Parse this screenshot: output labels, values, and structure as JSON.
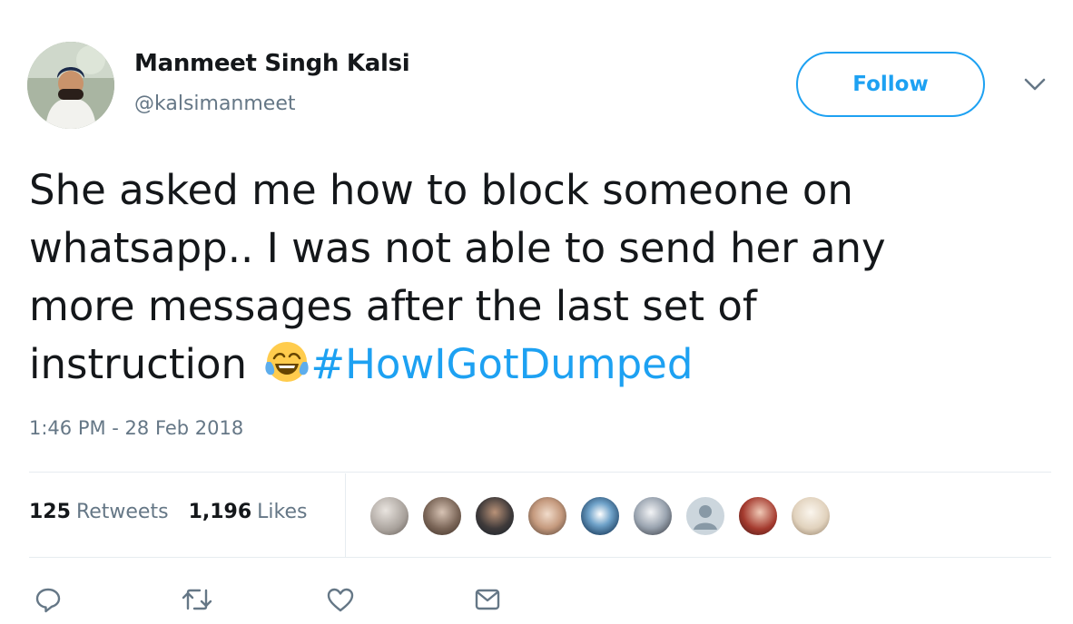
{
  "user": {
    "display_name": "Manmeet Singh Kalsi",
    "handle": "@kalsimanmeet",
    "avatar_icon": "profile-photo"
  },
  "follow_button": {
    "label": "Follow",
    "color": "#1da1f2"
  },
  "menu": {
    "icon": "chevron-down-icon"
  },
  "tweet": {
    "text_line1": "She asked me how to block someone  on",
    "text_line2": "whatsapp.. I was not able to send her any",
    "text_line3": "more messages after the last set of",
    "text_line4": "instruction ",
    "emoji": "face-with-tears-of-joy",
    "hashtag": "#HowIGotDumped",
    "hashtag_color": "#1da1f2"
  },
  "timestamp": "1:46 PM - 28 Feb 2018",
  "stats": {
    "retweets_count": "125",
    "retweets_label": "Retweets",
    "likes_count": "1,196",
    "likes_label": "Likes"
  },
  "likers": [
    {
      "icon": "liker-avatar"
    },
    {
      "icon": "liker-avatar"
    },
    {
      "icon": "liker-avatar"
    },
    {
      "icon": "liker-avatar"
    },
    {
      "icon": "liker-avatar"
    },
    {
      "icon": "liker-avatar"
    },
    {
      "icon": "default-avatar"
    },
    {
      "icon": "liker-avatar"
    },
    {
      "icon": "liker-avatar"
    }
  ],
  "actions": [
    {
      "icon": "reply-icon"
    },
    {
      "icon": "retweet-icon"
    },
    {
      "icon": "like-heart-icon"
    },
    {
      "icon": "direct-message-icon"
    }
  ],
  "colors": {
    "text": "#14171a",
    "secondary": "#657786",
    "accent": "#1da1f2",
    "divider": "#e6ecf0"
  }
}
